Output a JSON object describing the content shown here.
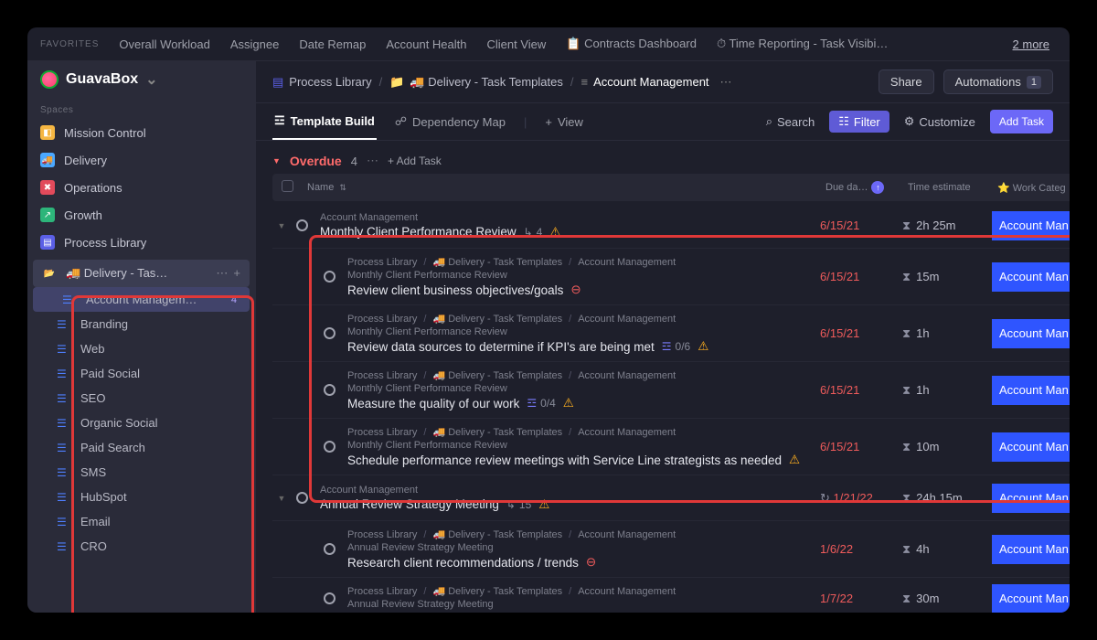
{
  "favorites": {
    "label": "FAVORITES",
    "items": [
      "Overall Workload",
      "Assignee",
      "Date Remap",
      "Account Health",
      "Client View",
      "📋 Contracts Dashboard",
      "⏱ Time Reporting - Task Visibi…"
    ],
    "more": "2 more"
  },
  "workspace": {
    "name": "GuavaBox"
  },
  "sidebar": {
    "spacesLabel": "Spaces",
    "spaces": [
      {
        "icon": "🟨",
        "label": "Mission Control",
        "color": "#f5b642"
      },
      {
        "icon": "🚚",
        "label": "Delivery",
        "color": "#4aa8ff"
      },
      {
        "icon": "✖",
        "label": "Operations",
        "color": "#e24a5b"
      },
      {
        "icon": "📈",
        "label": "Growth",
        "color": "#2db57a"
      },
      {
        "icon": "📘",
        "label": "Process Library",
        "color": "#5b5fe6"
      }
    ],
    "folder": {
      "label": "🚚 Delivery - Tas…"
    },
    "lists": [
      {
        "label": "Account Managem…",
        "count": "4",
        "active": true
      },
      {
        "label": "Branding"
      },
      {
        "label": "Web"
      },
      {
        "label": "Paid Social"
      },
      {
        "label": "SEO"
      },
      {
        "label": "Organic Social"
      },
      {
        "label": "Paid Search"
      },
      {
        "label": "SMS"
      },
      {
        "label": "HubSpot"
      },
      {
        "label": "Email"
      },
      {
        "label": "CRO"
      }
    ]
  },
  "breadcrumbs": {
    "items": [
      {
        "icon": "📘",
        "label": "Process Library"
      },
      {
        "icon": "📁",
        "label": "🚚 Delivery - Task Templates"
      },
      {
        "icon": "≡",
        "label": "Account Management"
      }
    ],
    "share": "Share",
    "automations": "Automations",
    "automationsCount": "1"
  },
  "viewbar": {
    "views": [
      {
        "icon": "☰",
        "label": "Template Build",
        "active": true
      },
      {
        "icon": "⇢",
        "label": "Dependency Map"
      },
      {
        "icon": "+",
        "label": "View"
      }
    ],
    "search": "Search",
    "filter": "Filter",
    "customize": "Customize",
    "addTask": "Add Task"
  },
  "group": {
    "name": "Overdue",
    "count": "4",
    "addTask": "+ Add Task"
  },
  "columns": {
    "name": "Name",
    "due": "Due da…",
    "time": "Time estimate",
    "cat": "⭐ Work Categ"
  },
  "catChip": "Account Man",
  "bc": {
    "a": "Process Library",
    "b": "🚚 Delivery - Task Templates",
    "c": "Account Management"
  },
  "parents": {
    "mcpr": "Monthly Client Performance Review",
    "arsm": "Annual Review Strategy Meeting",
    "am": "Account Management"
  },
  "tasks": [
    {
      "kind": "parent",
      "parentLine": "am",
      "title": "Monthly Client Performance Review",
      "subIcon": "↳",
      "subCount": "4",
      "warn": true,
      "due": "6/15/21",
      "time": "2h 25m"
    },
    {
      "kind": "sub",
      "parent": "mcpr",
      "title": "Review client business objectives/goals",
      "block": true,
      "due": "6/15/21",
      "time": "15m"
    },
    {
      "kind": "sub",
      "parent": "mcpr",
      "title": "Review data sources to determine if KPI's are being met",
      "checklist": "0/6",
      "warn": true,
      "due": "6/15/21",
      "time": "1h"
    },
    {
      "kind": "sub",
      "parent": "mcpr",
      "title": "Measure the quality of our work",
      "checklist": "0/4",
      "warn": true,
      "due": "6/15/21",
      "time": "1h"
    },
    {
      "kind": "sub",
      "parent": "mcpr",
      "title": "Schedule performance review meetings with Service Line strategists as needed",
      "warn": true,
      "due": "6/15/21",
      "time": "10m"
    },
    {
      "kind": "parent",
      "parentLine": "am",
      "title": "Annual Review Strategy Meeting",
      "subIcon": "↳",
      "subCount": "15",
      "warn": true,
      "recur": true,
      "due": "1/21/22",
      "time": "24h 15m"
    },
    {
      "kind": "sub",
      "parent": "arsm",
      "title": "Research client recommendations / trends",
      "block": true,
      "due": "1/6/22",
      "time": "4h"
    },
    {
      "kind": "sub",
      "parent": "arsm",
      "title": "",
      "partial": true,
      "due": "1/7/22",
      "time": "30m"
    }
  ]
}
